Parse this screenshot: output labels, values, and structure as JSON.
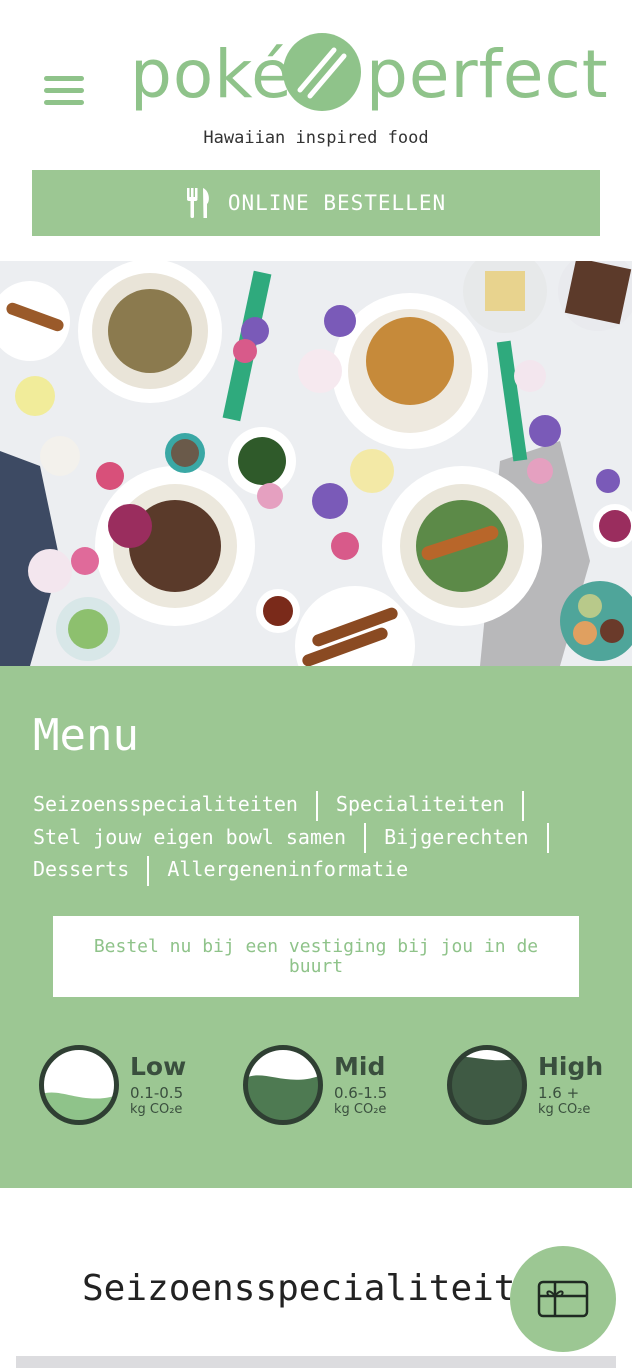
{
  "brand": {
    "logo_left": "poké",
    "logo_right": "perfect",
    "logo_accent": "´",
    "tagline": "Hawaiian inspired food",
    "color": "#8fc38a"
  },
  "header": {
    "menu_icon": "hamburger-icon",
    "order_button": "ONLINE BESTELLEN",
    "order_icon": "fork-knife-icon"
  },
  "hero": {
    "alt": "poke bowls on a table"
  },
  "menu": {
    "title": "Menu",
    "links": [
      "Seizoensspecialiteiten",
      "Specialiteiten",
      "Stel jouw eigen bowl samen",
      "Bijgerechten",
      "Desserts",
      "Allergeneninformatie"
    ],
    "cta": "Bestel nu bij een vestiging bij jou in de buurt",
    "co2": [
      {
        "level": "Low",
        "range": "0.1-0.5",
        "unit": "kg CO₂e",
        "fill": 0.3,
        "color": "#8fc38a"
      },
      {
        "level": "Mid",
        "range": "0.6-1.5",
        "unit": "kg CO₂e",
        "fill": 0.6,
        "color": "#4e7a52"
      },
      {
        "level": "High",
        "range": "1.6 +",
        "unit": "kg CO₂e",
        "fill": 0.85,
        "color": "#3f5a44"
      }
    ]
  },
  "section": {
    "title": "Seizoensspecialiteiten"
  },
  "fab": {
    "icon": "gift-card-icon"
  },
  "colors": {
    "accent": "#9cc793",
    "dark": "#3a4f3e"
  }
}
